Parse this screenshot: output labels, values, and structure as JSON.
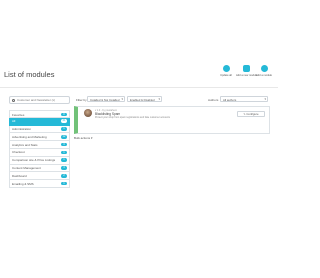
{
  "header": {
    "title": "List of modules",
    "toolbar": {
      "update_all": "Update all",
      "add_module": "Add a new module",
      "add_other": "Add a module"
    }
  },
  "sidebar": {
    "search_placeholder": "Customer and Newsletter (x)",
    "categories": [
      {
        "label": "Favorites",
        "count": "0"
      },
      {
        "label": "All",
        "count": "41"
      },
      {
        "label": "Administration",
        "count": "1"
      },
      {
        "label": "Advertising and Marketing",
        "count": "12"
      },
      {
        "label": "Analytics and Stats",
        "count": "3"
      },
      {
        "label": "Checkout",
        "count": "1"
      },
      {
        "label": "Comparison site & Price Listings",
        "count": "1"
      },
      {
        "label": "Content Management",
        "count": "4"
      },
      {
        "label": "Dashboard",
        "count": "2"
      },
      {
        "label": "Emailing & SMS",
        "count": "1"
      }
    ]
  },
  "filters": {
    "filter_by_label": "Filter by",
    "installed_select": "Installed & Not Installed",
    "enabled_select": "Enabled & Disabled",
    "authors_label": "Authors",
    "authors_select": "All authors"
  },
  "module": {
    "meta": "v 1.0 - by prestahero",
    "name": "Blacklisting Spam",
    "description": "Protect your shop from spam registrations and fake customer accounts",
    "configure_label": "Configure"
  },
  "bulk_action_label": "Bulk actions",
  "colors": {
    "accent": "#25b9d7",
    "installed_bar": "#72c279"
  }
}
